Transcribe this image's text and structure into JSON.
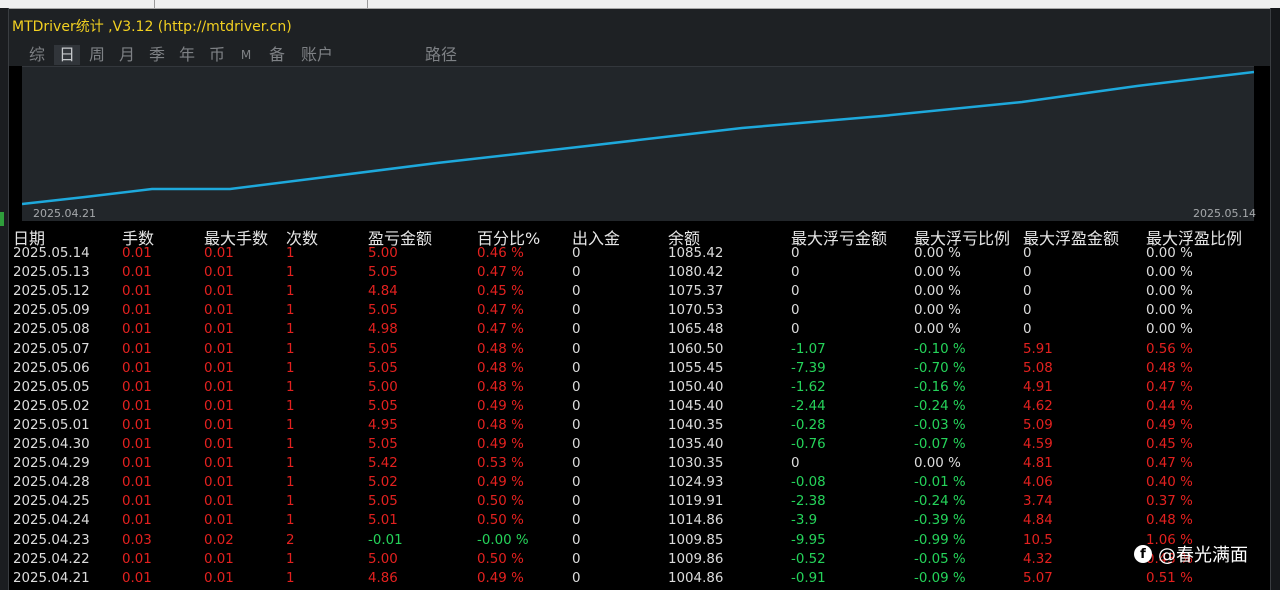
{
  "window": {
    "title": "MTDriver统计 ,V3.12 (http://mtdriver.cn)"
  },
  "tabs": [
    {
      "label": "综",
      "active": false
    },
    {
      "label": "日",
      "active": true
    },
    {
      "label": "周",
      "active": false
    },
    {
      "label": "月",
      "active": false
    },
    {
      "label": "季",
      "active": false
    },
    {
      "label": "年",
      "active": false
    },
    {
      "label": "币",
      "active": false
    },
    {
      "label": "M",
      "active": false
    },
    {
      "label": "备",
      "active": false
    },
    {
      "label": "账户",
      "active": false
    },
    {
      "label": "路径",
      "active": false
    }
  ],
  "chart": {
    "line_color": "#1ea9dc",
    "start_label": "2025.04.21",
    "end_label": "2025.05.14"
  },
  "table": {
    "headers": [
      "日期",
      "手数",
      "最大手数",
      "次数",
      "盈亏金额",
      "百分比%",
      "出入金",
      "余额",
      "最大浮亏金额",
      "最大浮亏比例",
      "最大浮盈金额",
      "最大浮盈比例"
    ],
    "rows": [
      [
        "2025.05.14",
        "0.01",
        "0.01",
        "1",
        "5.00",
        "0.46 %",
        "0",
        "1085.42",
        "0",
        "0.00 %",
        "0",
        "0.00 %"
      ],
      [
        "2025.05.13",
        "0.01",
        "0.01",
        "1",
        "5.05",
        "0.47 %",
        "0",
        "1080.42",
        "0",
        "0.00 %",
        "0",
        "0.00 %"
      ],
      [
        "2025.05.12",
        "0.01",
        "0.01",
        "1",
        "4.84",
        "0.45 %",
        "0",
        "1075.37",
        "0",
        "0.00 %",
        "0",
        "0.00 %"
      ],
      [
        "2025.05.09",
        "0.01",
        "0.01",
        "1",
        "5.05",
        "0.47 %",
        "0",
        "1070.53",
        "0",
        "0.00 %",
        "0",
        "0.00 %"
      ],
      [
        "2025.05.08",
        "0.01",
        "0.01",
        "1",
        "4.98",
        "0.47 %",
        "0",
        "1065.48",
        "0",
        "0.00 %",
        "0",
        "0.00 %"
      ],
      [
        "2025.05.07",
        "0.01",
        "0.01",
        "1",
        "5.05",
        "0.48 %",
        "0",
        "1060.50",
        "-1.07",
        "-0.10 %",
        "5.91",
        "0.56 %"
      ],
      [
        "2025.05.06",
        "0.01",
        "0.01",
        "1",
        "5.05",
        "0.48 %",
        "0",
        "1055.45",
        "-7.39",
        "-0.70 %",
        "5.08",
        "0.48 %"
      ],
      [
        "2025.05.05",
        "0.01",
        "0.01",
        "1",
        "5.00",
        "0.48 %",
        "0",
        "1050.40",
        "-1.62",
        "-0.16 %",
        "4.91",
        "0.47 %"
      ],
      [
        "2025.05.02",
        "0.01",
        "0.01",
        "1",
        "5.05",
        "0.49 %",
        "0",
        "1045.40",
        "-2.44",
        "-0.24 %",
        "4.62",
        "0.44 %"
      ],
      [
        "2025.05.01",
        "0.01",
        "0.01",
        "1",
        "4.95",
        "0.48 %",
        "0",
        "1040.35",
        "-0.28",
        "-0.03 %",
        "5.09",
        "0.49 %"
      ],
      [
        "2025.04.30",
        "0.01",
        "0.01",
        "1",
        "5.05",
        "0.49 %",
        "0",
        "1035.40",
        "-0.76",
        "-0.07 %",
        "4.59",
        "0.45 %"
      ],
      [
        "2025.04.29",
        "0.01",
        "0.01",
        "1",
        "5.42",
        "0.53 %",
        "0",
        "1030.35",
        "0",
        "0.00 %",
        "4.81",
        "0.47 %"
      ],
      [
        "2025.04.28",
        "0.01",
        "0.01",
        "1",
        "5.02",
        "0.49 %",
        "0",
        "1024.93",
        "-0.08",
        "-0.01 %",
        "4.06",
        "0.40 %"
      ],
      [
        "2025.04.25",
        "0.01",
        "0.01",
        "1",
        "5.05",
        "0.50 %",
        "0",
        "1019.91",
        "-2.38",
        "-0.24 %",
        "3.74",
        "0.37 %"
      ],
      [
        "2025.04.24",
        "0.01",
        "0.01",
        "1",
        "5.01",
        "0.50 %",
        "0",
        "1014.86",
        "-3.9",
        "-0.39 %",
        "4.84",
        "0.48 %"
      ],
      [
        "2025.04.23",
        "0.03",
        "0.02",
        "2",
        "-0.01",
        "-0.00 %",
        "0",
        "1009.85",
        "-9.95",
        "-0.99 %",
        "10.5",
        "1.06 %"
      ],
      [
        "2025.04.22",
        "0.01",
        "0.01",
        "1",
        "5.00",
        "0.50 %",
        "0",
        "1009.86",
        "-0.52",
        "-0.05 %",
        "4.32",
        "0.43 %"
      ],
      [
        "2025.04.21",
        "0.01",
        "0.01",
        "1",
        "4.86",
        "0.49 %",
        "0",
        "1004.86",
        "-0.91",
        "-0.09 %",
        "5.07",
        "0.51 %"
      ]
    ]
  },
  "colors": {
    "positive": "#e3211f",
    "negative": "#25d35a",
    "neutral": "#dcdcdc",
    "title": "#f2d021"
  },
  "watermark": {
    "icon": "watermark-logo-icon",
    "text": "@春光满面"
  }
}
